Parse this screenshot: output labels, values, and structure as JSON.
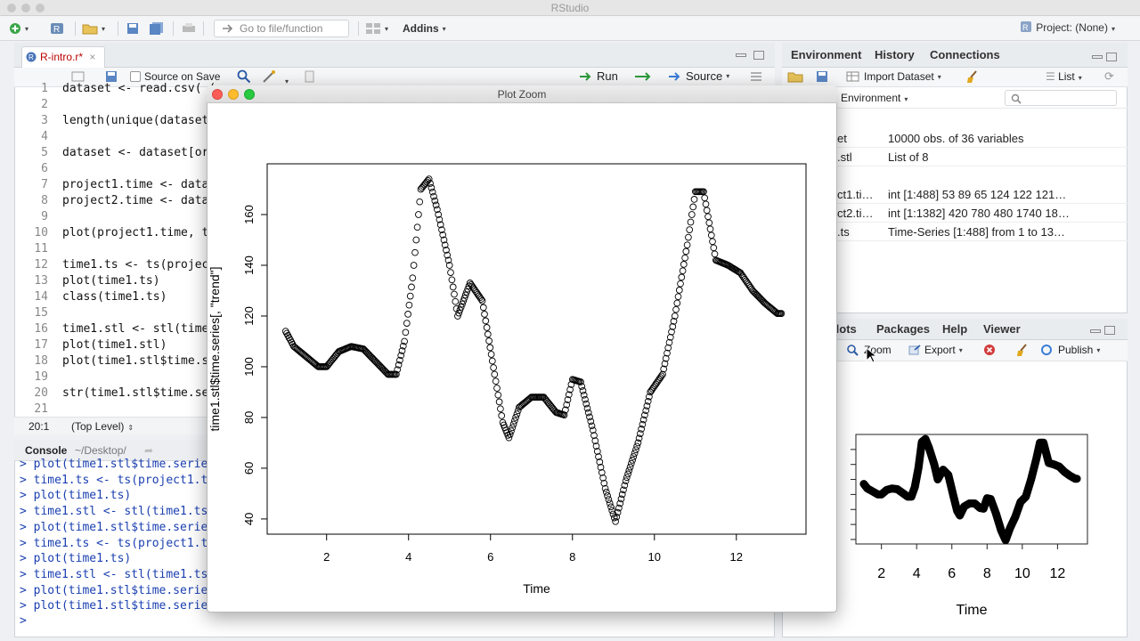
{
  "app": {
    "title": "RStudio"
  },
  "toolbar": {
    "goto_placeholder": "Go to file/function",
    "addins": "Addins",
    "project": "Project: (None)"
  },
  "editor": {
    "tab_label": "R-intro.r*",
    "source_on_save": "Source on Save",
    "run": "Run",
    "source": "Source",
    "status_pos": "20:1",
    "status_scope": "(Top Level)",
    "lines": [
      {
        "n": "1",
        "code": "dataset <- read.csv( ("
      },
      {
        "n": "2",
        "code": ""
      },
      {
        "n": "3",
        "code": "length(unique(dataset$"
      },
      {
        "n": "4",
        "code": ""
      },
      {
        "n": "5",
        "code": "dataset <- dataset[ord"
      },
      {
        "n": "6",
        "code": ""
      },
      {
        "n": "7",
        "code": "project1.time <- datas"
      },
      {
        "n": "8",
        "code": "project2.time <- datas"
      },
      {
        "n": "9",
        "code": ""
      },
      {
        "n": "10",
        "code": "plot(project1.time, ty"
      },
      {
        "n": "11",
        "code": ""
      },
      {
        "n": "12",
        "code": "time1.ts <- ts(project"
      },
      {
        "n": "13",
        "code": "plot(time1.ts)"
      },
      {
        "n": "14",
        "code": "class(time1.ts)"
      },
      {
        "n": "15",
        "code": ""
      },
      {
        "n": "16",
        "code": "time1.stl <- stl(time1"
      },
      {
        "n": "17",
        "code": "plot(time1.stl)"
      },
      {
        "n": "18",
        "code": "plot(time1.stl$time.se"
      },
      {
        "n": "19",
        "code": ""
      },
      {
        "n": "20",
        "code": "str(time1.stl$time.ser"
      },
      {
        "n": "21",
        "code": ""
      }
    ]
  },
  "console": {
    "title": "Console",
    "path": "~/Desktop/",
    "lines": [
      "> plot(time1.stl$time.series",
      "> time1.ts <- ts(project1.ti",
      "> plot(time1.ts)",
      "> time1.stl <- stl(time1.ts,",
      "> plot(time1.stl$time.series",
      "> time1.ts <- ts(project1.ti",
      "> plot(time1.ts)",
      "> time1.stl <- stl(time1.ts,",
      "> plot(time1.stl$time.series",
      "> plot(time1.stl$time.series"
    ],
    "prompt": ">"
  },
  "env": {
    "tabs": [
      "Environment",
      "History",
      "Connections"
    ],
    "import_dataset": "Import Dataset",
    "list_view": "List",
    "scope": "l Environment",
    "rows": [
      {
        "name": "et",
        "value": "10000 obs. of 36 variables"
      },
      {
        "name": ".stl",
        "value": "List of 8"
      },
      {
        "name": "ct1.ti…",
        "value": "int [1:488] 53 89 65 124 122 121…"
      },
      {
        "name": "ct2.ti…",
        "value": "int [1:1382] 420 780 480 1740 18…"
      },
      {
        "name": ".ts",
        "value": "Time-Series [1:488] from 1 to 13…"
      }
    ]
  },
  "plots": {
    "tabs": [
      "Plots",
      "Packages",
      "Help",
      "Viewer"
    ],
    "zoom": "Zoom",
    "export": "Export",
    "publish": "Publish",
    "xticks": [
      "2",
      "4",
      "6",
      "8",
      "10",
      "12"
    ],
    "xlabel": "Time"
  },
  "zoom_window": {
    "title": "Plot Zoom"
  },
  "colors": {
    "accent": "#3b7dd8",
    "code_blue": "#1a3fb0",
    "run_green": "#2e9b3c"
  },
  "chart_data": {
    "type": "scatter",
    "title": "",
    "xlabel": "Time",
    "ylabel": "time1.stl$time.series[, \"trend\"]",
    "xlim": [
      0.55,
      13.7
    ],
    "ylim": [
      34,
      180
    ],
    "xticks": [
      2,
      4,
      6,
      8,
      10,
      12
    ],
    "yticks": [
      40,
      60,
      80,
      100,
      120,
      140,
      160
    ],
    "series": [
      {
        "anchors_x": [
          1,
          1.2,
          1.5,
          1.8,
          2,
          2.3,
          2.6,
          2.9,
          3.2,
          3.5,
          3.7,
          3.9,
          4.1,
          4.3,
          4.5,
          4.7,
          5.0,
          5.2,
          5.5,
          5.8,
          6.1,
          6.3,
          6.45,
          6.7,
          7.0,
          7.3,
          7.6,
          7.8,
          8.0,
          8.2,
          8.5,
          8.8,
          9.05,
          9.3,
          9.6,
          9.9,
          10.2,
          10.5,
          10.8,
          11.0,
          11.2,
          11.5,
          11.8,
          12.1,
          12.4,
          12.7,
          13.0,
          13.1
        ],
        "anchors_y": [
          114,
          108,
          104,
          100,
          100,
          106,
          108,
          107,
          102,
          97,
          97,
          110,
          135,
          170,
          174,
          162,
          140,
          120,
          133,
          126,
          97,
          78,
          72,
          84,
          88,
          88,
          82,
          81,
          95,
          94,
          75,
          52,
          39,
          55,
          70,
          90,
          97,
          120,
          148,
          169,
          169,
          142,
          140,
          137,
          130,
          125,
          121,
          121
        ]
      }
    ]
  }
}
